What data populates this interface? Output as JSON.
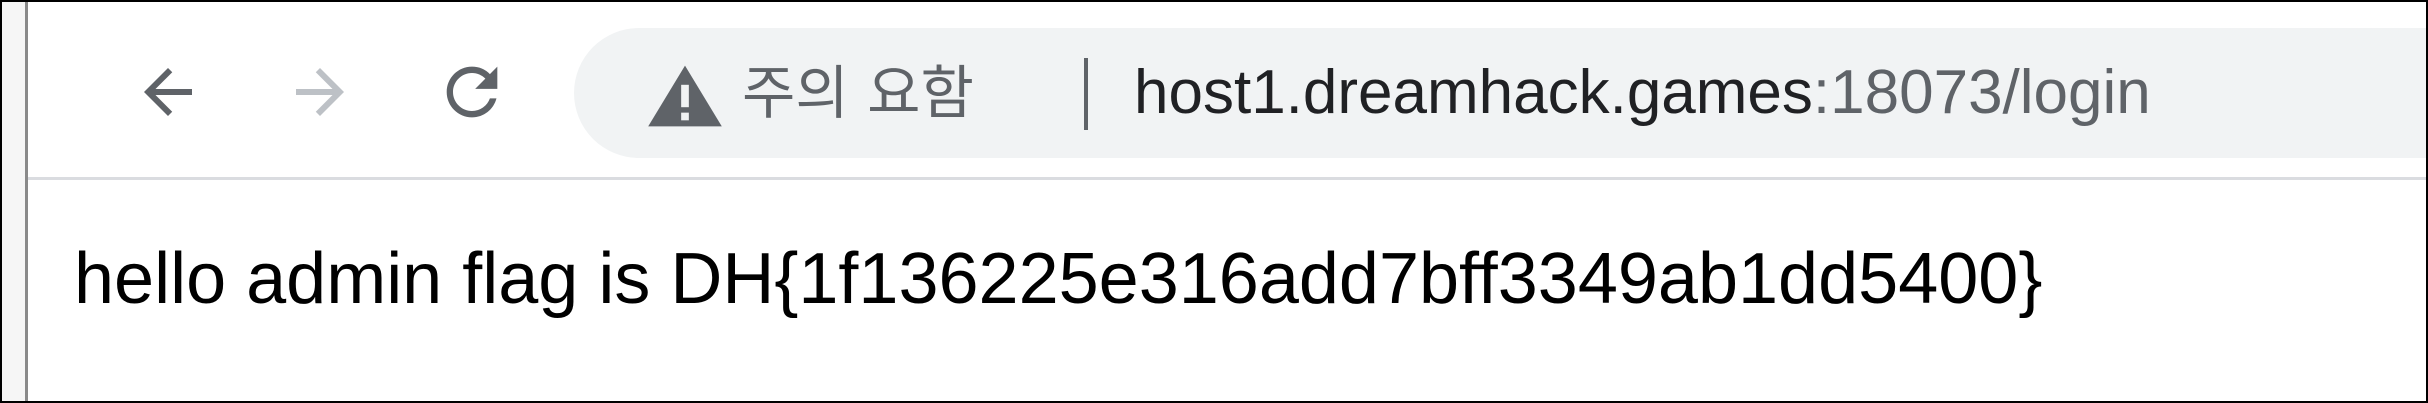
{
  "toolbar": {
    "back_icon": "arrow-left-icon",
    "forward_icon": "arrow-right-icon",
    "reload_icon": "reload-icon",
    "forward_enabled": false
  },
  "omnibox": {
    "security_icon": "warning-triangle-icon",
    "security_label": "주의 요함",
    "url_host": "host1.dreamhack.games",
    "url_rest": ":18073/login"
  },
  "page": {
    "body_text": "hello admin flag is DH{1f136225e316add7bff3349ab1dd5400}"
  },
  "colors": {
    "icon_active": "#5f6368",
    "icon_disabled": "#bdc1c6",
    "omnibox_bg": "#f1f3f4",
    "url_host": "#202124",
    "url_rest": "#5f6368",
    "text": "#000000"
  }
}
